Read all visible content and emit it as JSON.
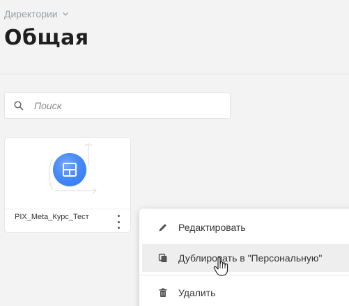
{
  "breadcrumb": {
    "label": "Директории",
    "icon": "chevron-down-icon"
  },
  "page": {
    "title": "Общая"
  },
  "search": {
    "placeholder": "Поиск",
    "value": "",
    "icon": "search-icon"
  },
  "card": {
    "name": "PIX_Meta_Курс_Тест",
    "thumbnail_icon": "grid-window-icon",
    "thumbnail_color": "#3b82f6",
    "more_icon": "more-vertical-icon"
  },
  "context_menu": {
    "items": [
      {
        "label": "Редактировать",
        "icon": "pencil-icon"
      },
      {
        "label": "Дублировать в \"Персональную\"",
        "icon": "duplicate-icon"
      },
      {
        "label": "Удалить",
        "icon": "trash-icon"
      }
    ]
  },
  "colors": {
    "background": "#f3f3f3",
    "accent_blue": "#3b82f6",
    "menu_hover": "#eeeeee"
  }
}
